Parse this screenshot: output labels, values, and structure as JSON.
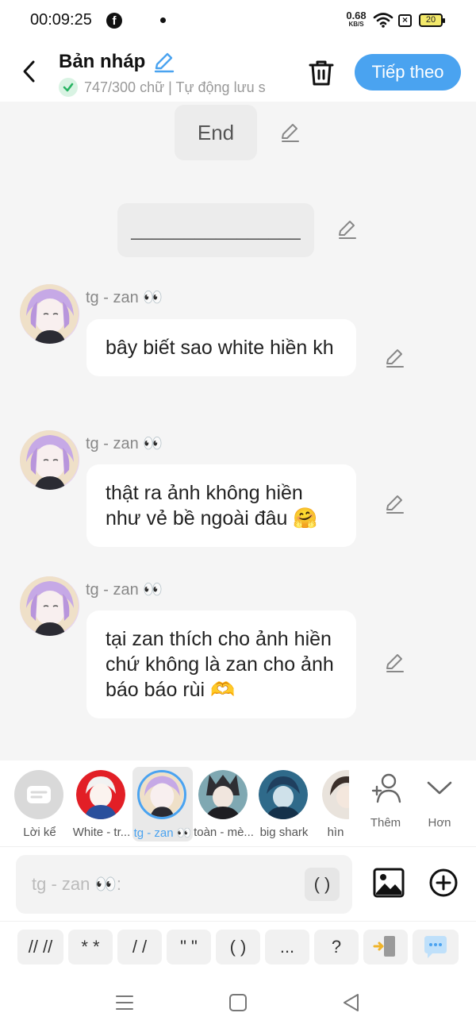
{
  "status_bar": {
    "time": "00:09:25",
    "net_speed_value": "0.68",
    "net_speed_unit": "KB/S",
    "battery": "20",
    "sim_glyph": "×",
    "icons": [
      "facebook-icon",
      "wifi-icon",
      "no-sim-icon",
      "battery-icon"
    ]
  },
  "header": {
    "title": "Bản nháp",
    "subtitle": "747/300 chữ | Tự động lưu s",
    "next_label": "Tiếp theo",
    "accent_color": "#4aa3f0"
  },
  "chat": {
    "end_label": "End",
    "separator_label": "________________",
    "messages": [
      {
        "sender": "tg - zan 👀",
        "text": "bây biết sao white hiền kh"
      },
      {
        "sender": "tg - zan 👀",
        "text": "thật ra ảnh không hiền như vẻ bề ngoài đâu 🤗"
      },
      {
        "sender": "tg - zan 👀",
        "text": "tại zan thích cho ảnh hiền chứ không là zan cho ảnh báo báo rùi 🫶"
      }
    ]
  },
  "characters": [
    {
      "label": "Lời kể"
    },
    {
      "label": "White - tr..."
    },
    {
      "label": "tg - zan 👀",
      "selected": true
    },
    {
      "label": "toàn - mè..."
    },
    {
      "label": "big shark"
    },
    {
      "label": "hìn"
    }
  ],
  "tools": {
    "add_label": "Thêm",
    "more_label": "Hơn"
  },
  "input": {
    "placeholder": "tg - zan 👀:",
    "paren_label": "( )"
  },
  "shortcuts": [
    "// //",
    "* *",
    "/ /",
    "\" \"",
    "( )",
    "...",
    "?"
  ]
}
